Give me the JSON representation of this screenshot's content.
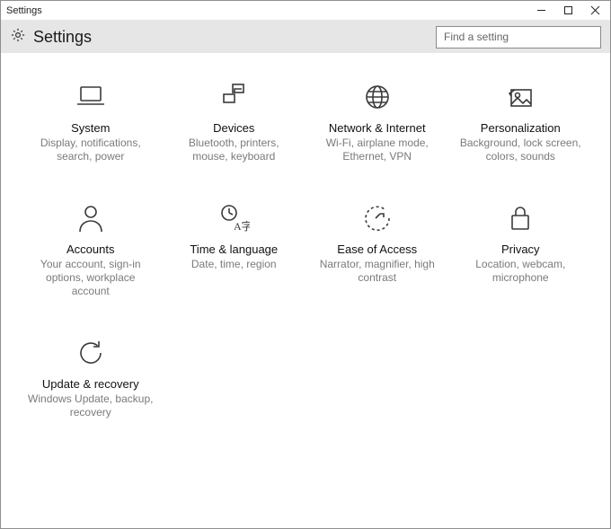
{
  "window": {
    "title": "Settings"
  },
  "header": {
    "title": "Settings"
  },
  "search": {
    "placeholder": "Find a setting"
  },
  "tiles": {
    "system": {
      "title": "System",
      "desc": "Display, notifications, search, power"
    },
    "devices": {
      "title": "Devices",
      "desc": "Bluetooth, printers, mouse, keyboard"
    },
    "network": {
      "title": "Network & Internet",
      "desc": "Wi-Fi, airplane mode, Ethernet, VPN"
    },
    "personalization": {
      "title": "Personalization",
      "desc": "Background, lock screen, colors, sounds"
    },
    "accounts": {
      "title": "Accounts",
      "desc": "Your account, sign-in options, workplace account"
    },
    "time": {
      "title": "Time & language",
      "desc": "Date, time, region"
    },
    "ease": {
      "title": "Ease of Access",
      "desc": "Narrator, magnifier, high contrast"
    },
    "privacy": {
      "title": "Privacy",
      "desc": "Location, webcam, microphone"
    },
    "update": {
      "title": "Update & recovery",
      "desc": "Windows Update, backup, recovery"
    }
  }
}
